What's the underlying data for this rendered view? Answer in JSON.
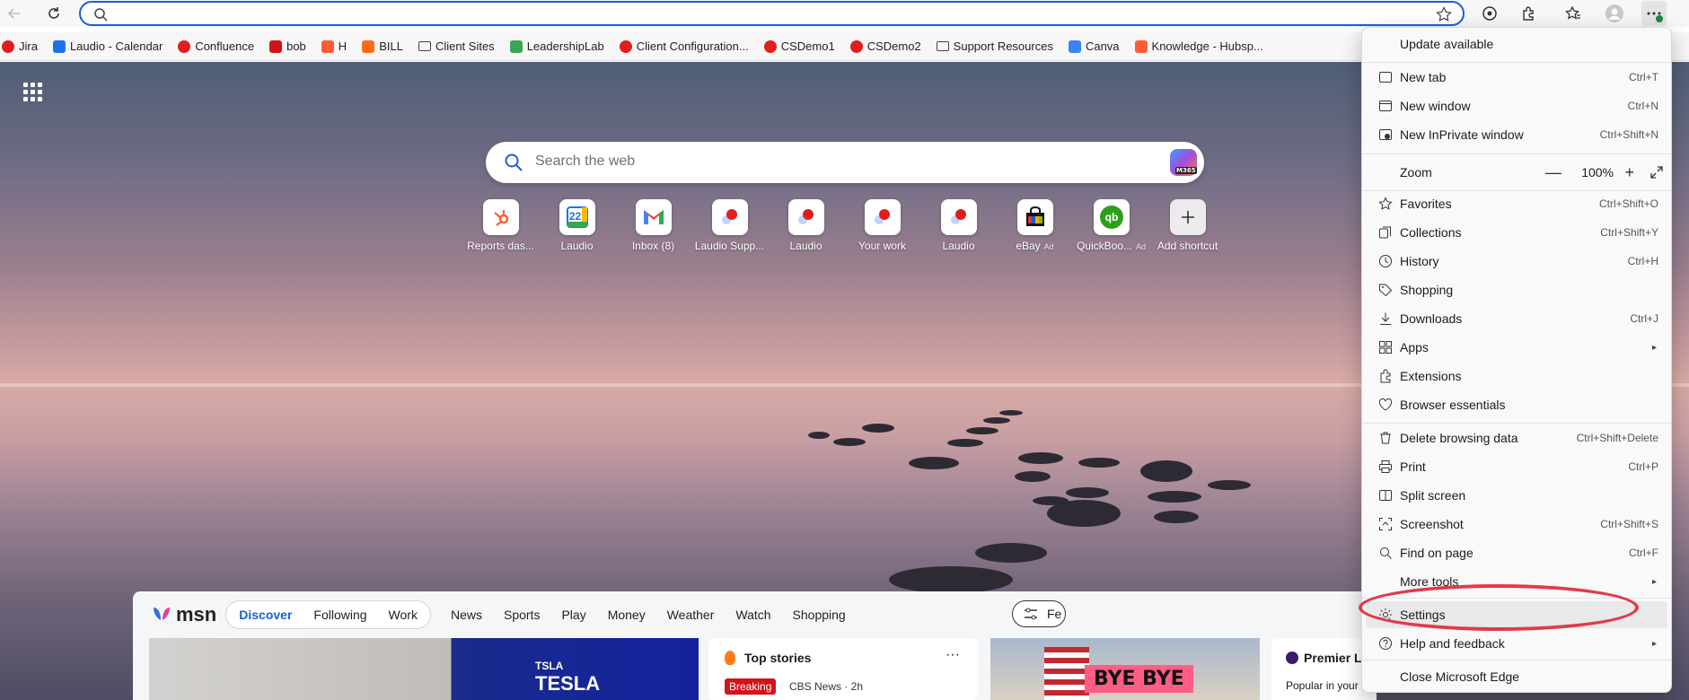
{
  "address_bar": {
    "value": "",
    "placeholder": ""
  },
  "bookmarks": [
    {
      "label": "Jira",
      "color": "#e21d1d"
    },
    {
      "label": "Laudio - Calendar",
      "color": "#1a73e8"
    },
    {
      "label": "Confluence",
      "color": "#e21d1d"
    },
    {
      "label": "bob",
      "color": "#d3131a"
    },
    {
      "label": "H",
      "color": "#ff5c35"
    },
    {
      "label": "BILL",
      "color": "#ff6a13"
    },
    {
      "label": "Client Sites",
      "color": "folder"
    },
    {
      "label": "LeadershipLab",
      "color": "#3aa655"
    },
    {
      "label": "Client Configuration...",
      "color": "#e21d1d"
    },
    {
      "label": "CSDemo1",
      "color": "#e21d1d"
    },
    {
      "label": "CSDemo2",
      "color": "#e21d1d"
    },
    {
      "label": "Support Resources",
      "color": "folder"
    },
    {
      "label": "Canva",
      "color": "#3b82f6"
    },
    {
      "label": "Knowledge - Hubsp...",
      "color": "#ff5c35"
    }
  ],
  "search": {
    "placeholder": "Search the web",
    "m365_badge": "M365"
  },
  "shortcuts": [
    {
      "label": "Reports das...",
      "icon": "hubspot-icon"
    },
    {
      "label": "Laudio",
      "icon": "calendar-icon",
      "calendar_day": "22"
    },
    {
      "label": "Inbox (8)",
      "icon": "gmail-icon"
    },
    {
      "label": "Laudio Supp...",
      "icon": "laudio-icon"
    },
    {
      "label": "Laudio",
      "icon": "laudio-icon"
    },
    {
      "label": "Your work",
      "icon": "laudio-icon"
    },
    {
      "label": "Laudio",
      "icon": "laudio-icon"
    },
    {
      "label": "eBay",
      "ad": "Ad",
      "icon": "ebay-icon"
    },
    {
      "label": "QuickBoo...",
      "ad": "Ad",
      "icon": "quickbooks-icon",
      "logo_text": "qb"
    },
    {
      "label": "Add shortcut",
      "icon": "plus-icon"
    }
  ],
  "feed": {
    "logo": "msn",
    "pills": [
      "Discover",
      "Following",
      "Work"
    ],
    "links": [
      "News",
      "Sports",
      "Play",
      "Money",
      "Weather",
      "Watch",
      "Shopping"
    ],
    "settings_label": "Fe",
    "card1": {
      "small": "TSLA",
      "big": "TESLA"
    },
    "card2": {
      "title": "Top stories",
      "more": "···",
      "badge": "Breaking",
      "source": "CBS News · 2h"
    },
    "card3": {
      "sign": "BYE BYE"
    },
    "card4": {
      "title": "Premier L",
      "sub": "Popular in your"
    }
  },
  "menu": {
    "update": "Update available",
    "new_tab": {
      "label": "New tab",
      "shortcut": "Ctrl+T"
    },
    "new_window": {
      "label": "New window",
      "shortcut": "Ctrl+N"
    },
    "inprivate": {
      "label": "New InPrivate window",
      "shortcut": "Ctrl+Shift+N"
    },
    "zoom": {
      "label": "Zoom",
      "value": "100%",
      "minus": "—",
      "plus": "+"
    },
    "favorites": {
      "label": "Favorites",
      "shortcut": "Ctrl+Shift+O"
    },
    "collections": {
      "label": "Collections",
      "shortcut": "Ctrl+Shift+Y"
    },
    "history": {
      "label": "History",
      "shortcut": "Ctrl+H"
    },
    "shopping": {
      "label": "Shopping"
    },
    "downloads": {
      "label": "Downloads",
      "shortcut": "Ctrl+J"
    },
    "apps": {
      "label": "Apps"
    },
    "extensions": {
      "label": "Extensions"
    },
    "essentials": {
      "label": "Browser essentials"
    },
    "delete_data": {
      "label": "Delete browsing data",
      "shortcut": "Ctrl+Shift+Delete"
    },
    "print": {
      "label": "Print",
      "shortcut": "Ctrl+P"
    },
    "split": {
      "label": "Split screen"
    },
    "screenshot": {
      "label": "Screenshot",
      "shortcut": "Ctrl+Shift+S"
    },
    "find": {
      "label": "Find on page",
      "shortcut": "Ctrl+F"
    },
    "more_tools": {
      "label": "More tools"
    },
    "settings": {
      "label": "Settings"
    },
    "help": {
      "label": "Help and feedback"
    },
    "close": {
      "label": "Close Microsoft Edge"
    }
  },
  "colors": {
    "accent": "#1a5fd6",
    "annotation": "#e03a4c"
  }
}
